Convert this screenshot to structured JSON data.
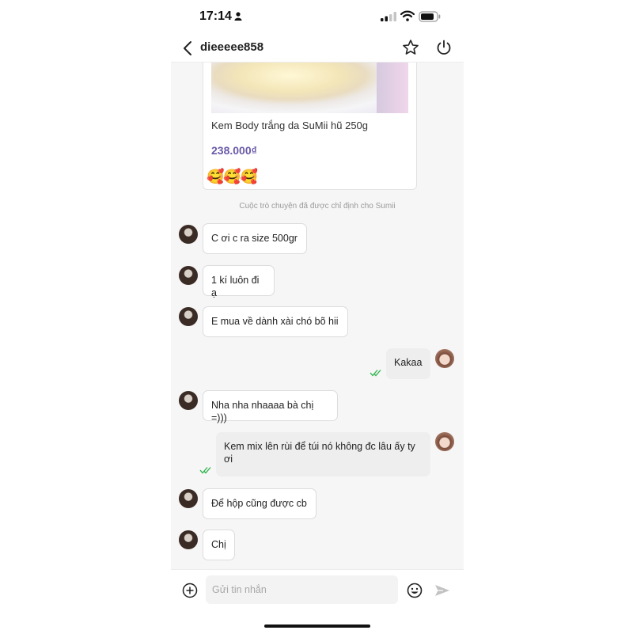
{
  "status_bar": {
    "time": "17:14"
  },
  "header": {
    "title": "dieeeee858"
  },
  "product": {
    "name": "Kem Body trắng da SuMii hũ 250g",
    "price": "238.000₫",
    "emojis": "🥰🥰🥰"
  },
  "system_note": "Cuộc trò chuyện đã được chỉ định cho Sumii",
  "messages": [
    {
      "side": "in",
      "text": "C ơi c ra size 500gr"
    },
    {
      "side": "in",
      "text": "1 kí luôn đi ạ"
    },
    {
      "side": "in",
      "text": "E mua về dành xài chó bõ hii"
    },
    {
      "side": "out",
      "text": "Kakaa",
      "read": true
    },
    {
      "side": "in",
      "text": "Nha nha nhaaaa bà chị =)))"
    },
    {
      "side": "out",
      "text": "Kem mix lên rùi để túi nó không đc lâu ấy ty ơi",
      "read": true
    },
    {
      "side": "in",
      "text": "Để hộp cũng được cb"
    },
    {
      "side": "in",
      "text": "Chị"
    }
  ],
  "input": {
    "placeholder": "Gửi tin nhắn",
    "value": ""
  },
  "colors": {
    "price": "#6a5aa8",
    "read_check": "#2db34a",
    "bubble_out": "#eeeeee"
  },
  "icons": [
    "person-icon",
    "signal-icon",
    "wifi-icon",
    "battery-icon",
    "back-icon",
    "star-icon",
    "power-icon",
    "add-icon",
    "emoji-icon",
    "send-icon"
  ]
}
